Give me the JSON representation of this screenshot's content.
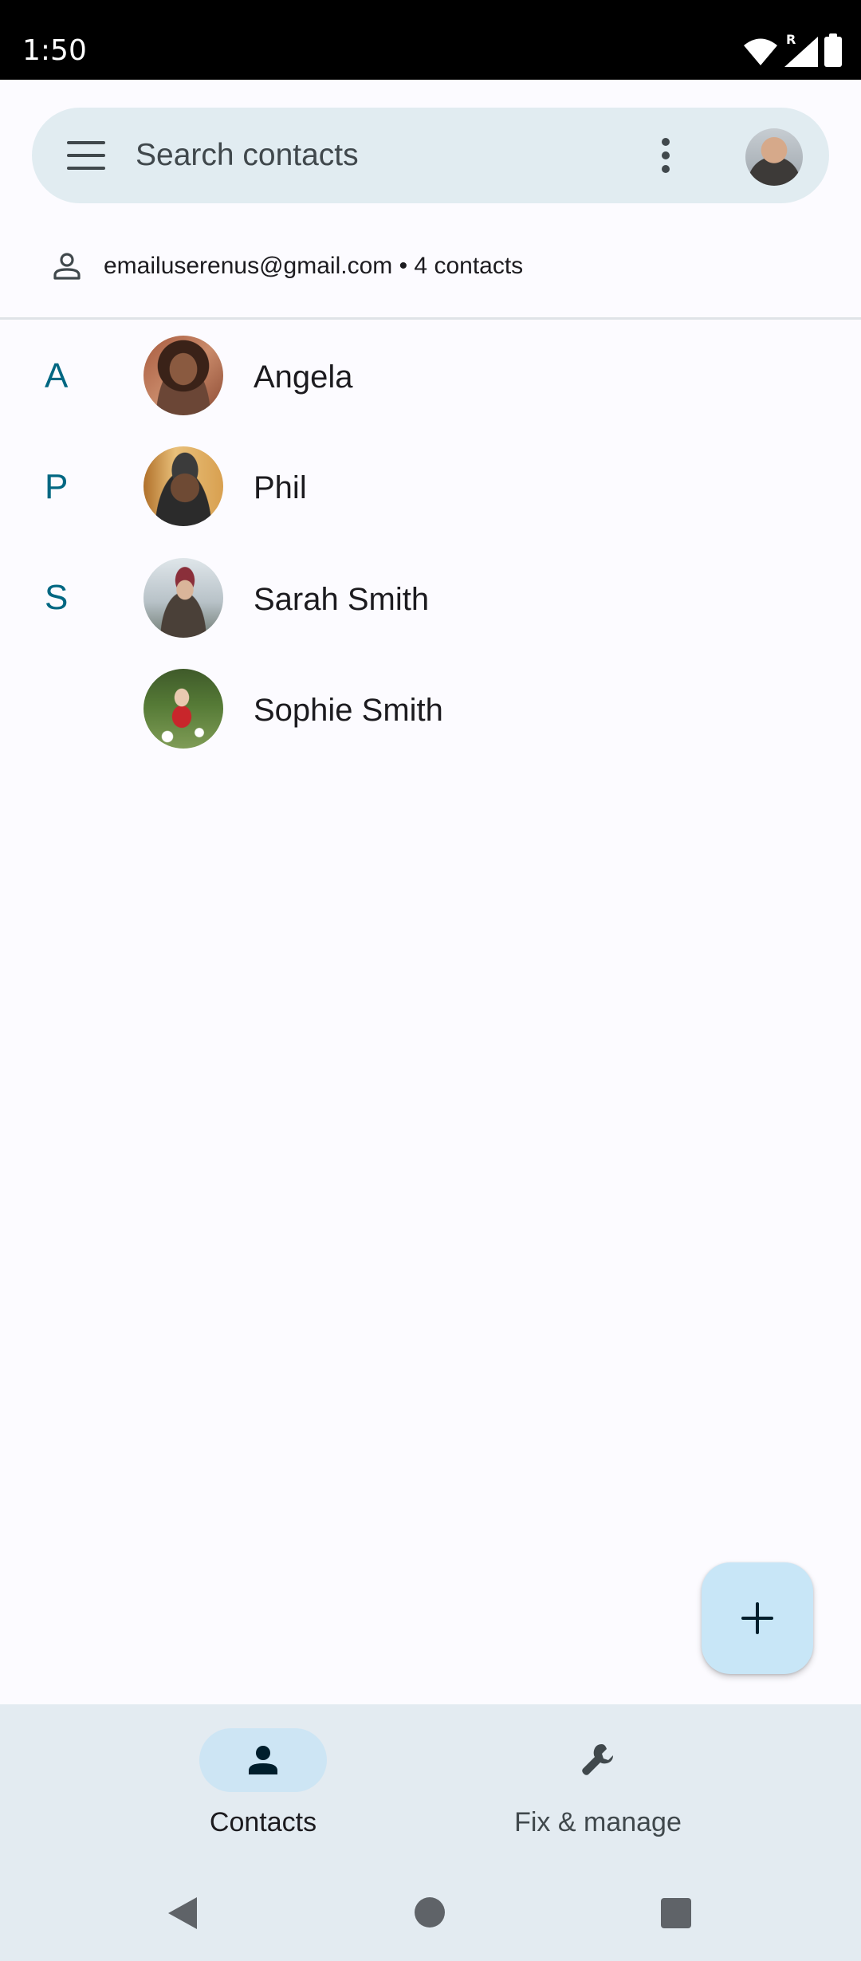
{
  "status_bar": {
    "time": "1:50",
    "network_badge": "R",
    "icons": [
      "wifi-icon",
      "signal-icon",
      "battery-icon"
    ]
  },
  "search_bar": {
    "placeholder": "Search contacts",
    "icons": [
      "menu-icon",
      "more-vert-icon",
      "account-avatar"
    ]
  },
  "account": {
    "summary": "emailuserenus@gmail.com • 4 contacts",
    "icon": "person-outline-icon"
  },
  "contacts": {
    "sections": [
      {
        "letter": "A",
        "names": [
          "Angela"
        ]
      },
      {
        "letter": "P",
        "names": [
          "Phil"
        ]
      },
      {
        "letter": "S",
        "names": [
          "Sarah Smith",
          "Sophie Smith"
        ]
      }
    ],
    "rows": [
      {
        "letter": "A",
        "name": "Angela"
      },
      {
        "letter": "P",
        "name": "Phil"
      },
      {
        "letter": "S",
        "name": "Sarah Smith"
      },
      {
        "letter": "",
        "name": "Sophie Smith"
      }
    ]
  },
  "fab": {
    "icon": "plus-icon"
  },
  "bottom_nav": {
    "items": [
      {
        "label": "Contacts",
        "icon": "person-icon",
        "selected": true
      },
      {
        "label": "Fix & manage",
        "icon": "wrench-icon",
        "selected": false
      }
    ]
  },
  "system_nav": {
    "buttons": [
      "back-button",
      "home-button",
      "recents-button"
    ]
  },
  "colors": {
    "accent": "#006782",
    "search_bar_bg": "#e1ecf1",
    "fab_bg": "#c8e6f7",
    "nav_bg": "#e3ebf1",
    "nav_indicator": "#cde5f4"
  }
}
